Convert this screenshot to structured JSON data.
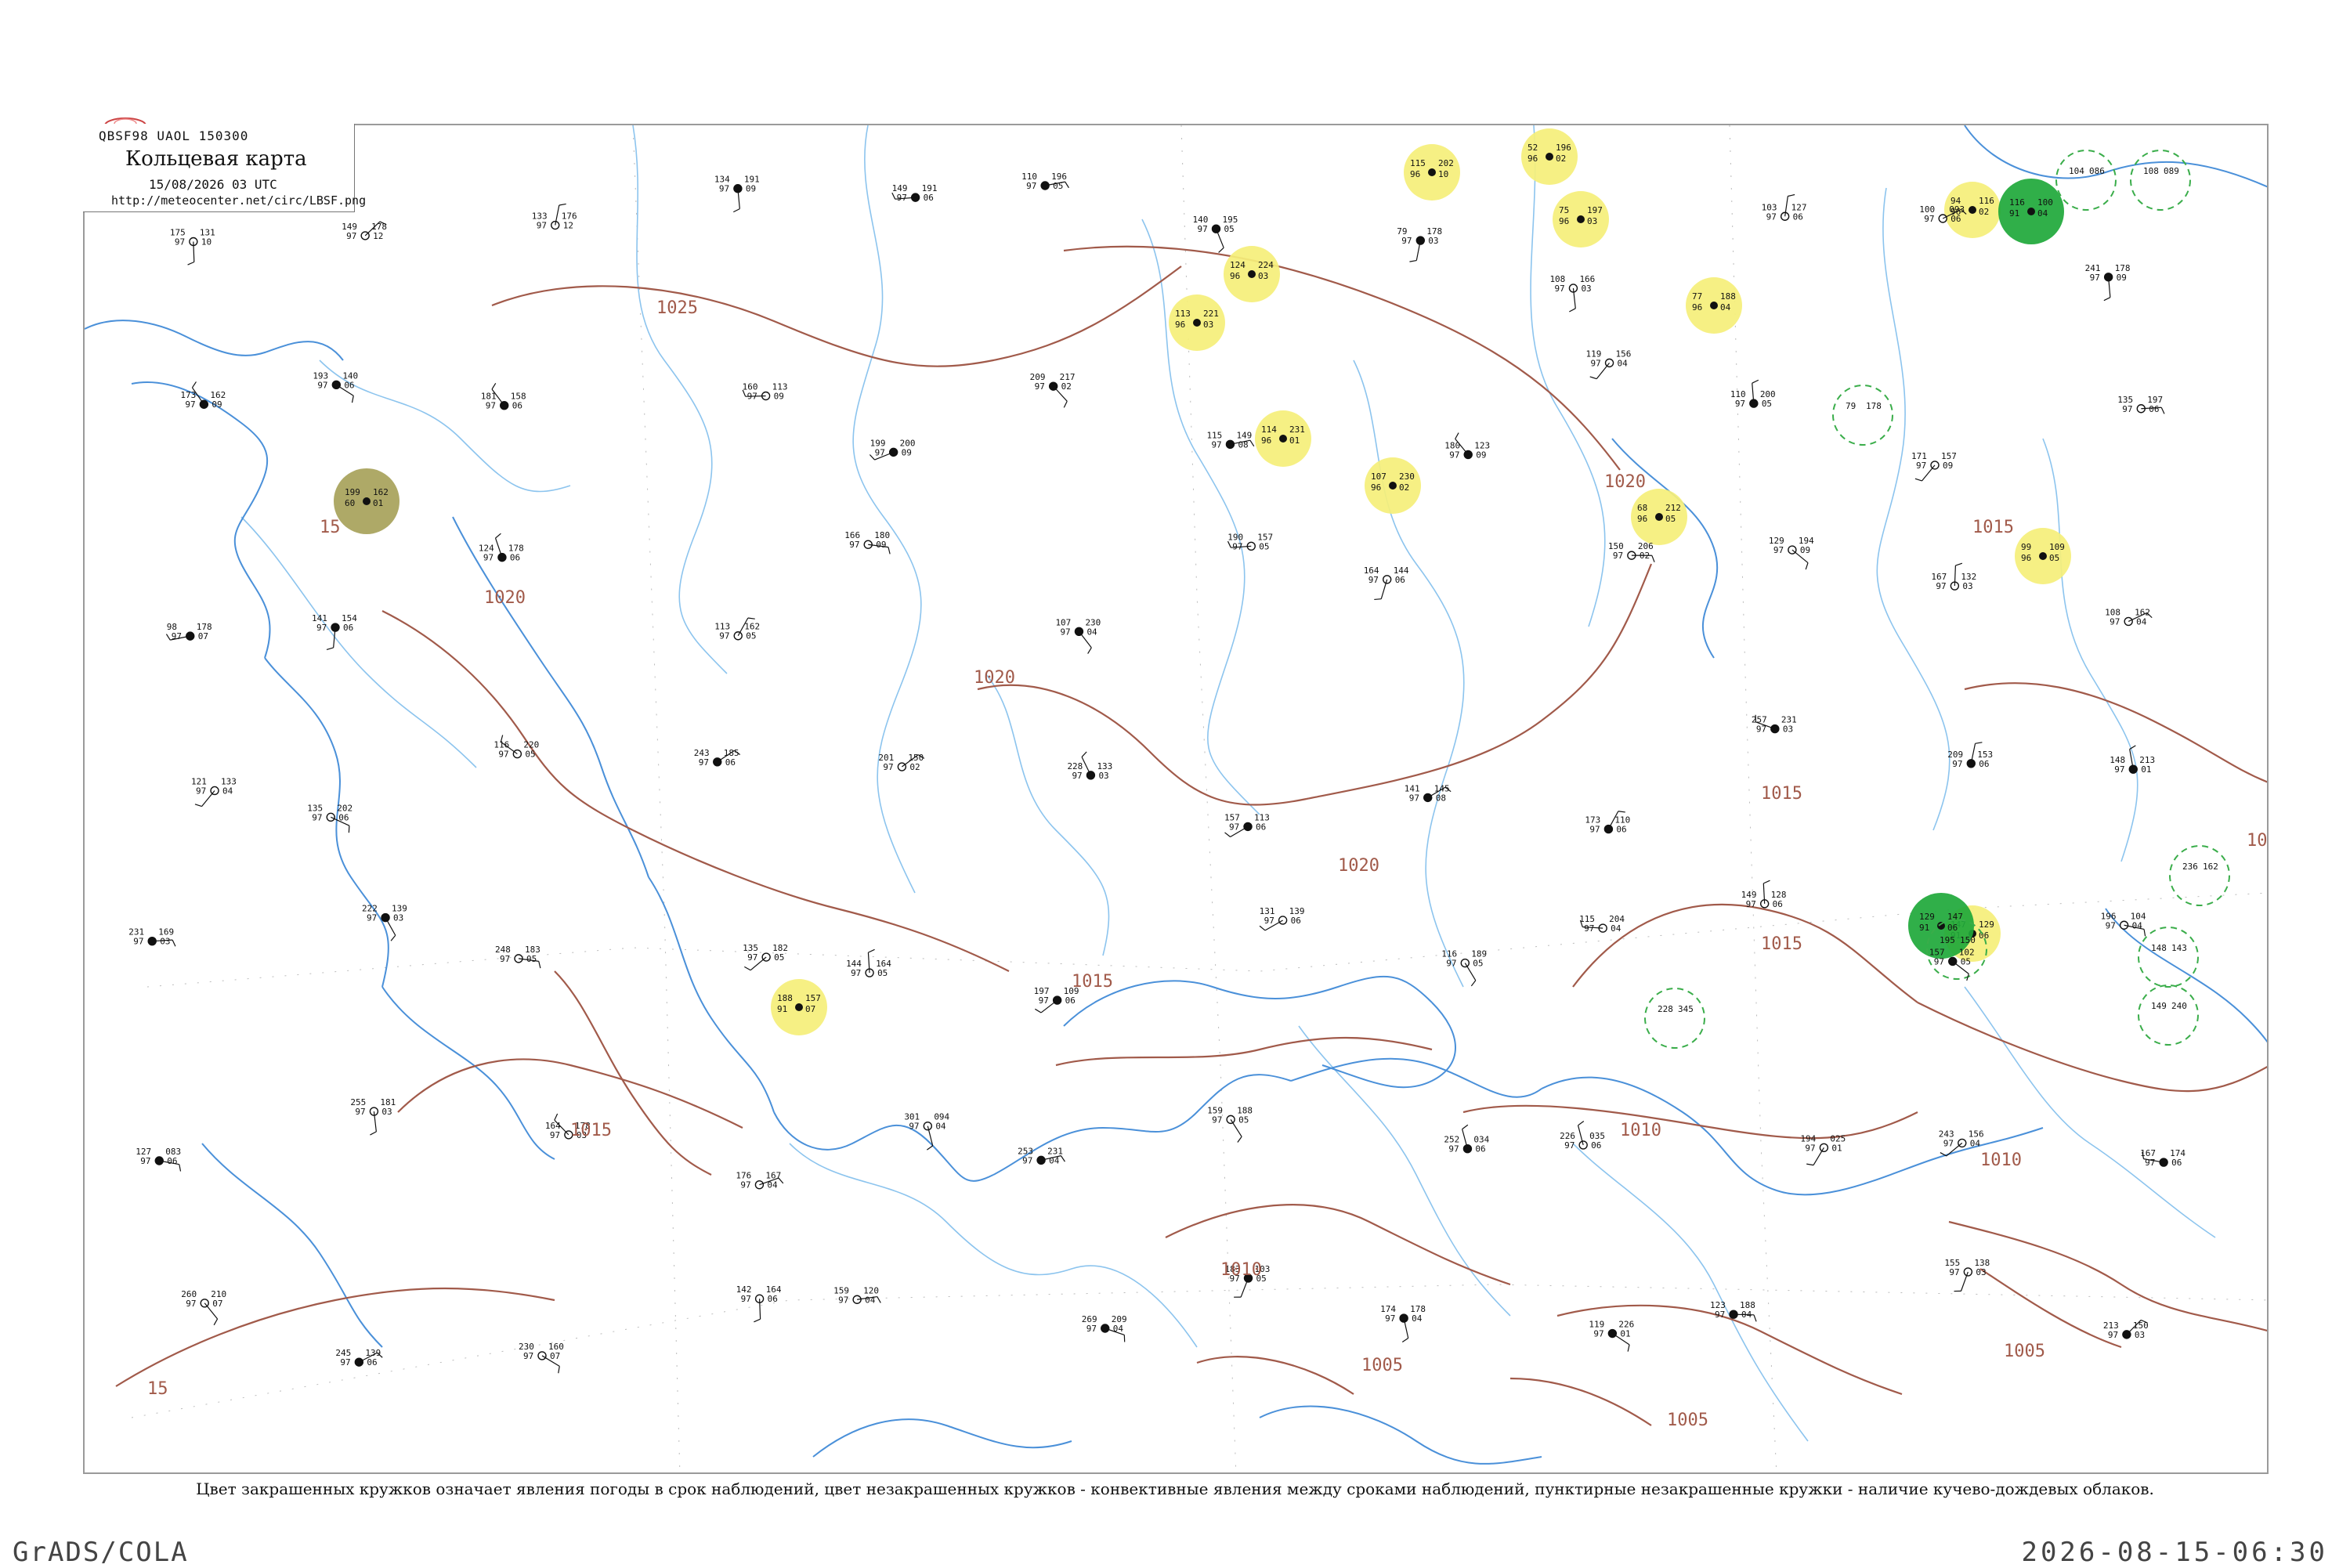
{
  "header": {
    "code_line": "QBSF98  UAOL  150300",
    "title": "Кольцевая карта",
    "time": "15/08/2026 03 UTC",
    "url": "http://meteocenter.net/circ/LBSF.png"
  },
  "caption": "Цвет закрашенных кружков означает явления погоды в срок наблюдений, цвет незакрашенных кружков - конвективные явления между сроками наблюдений, пунктирные незакрашенные кружки - наличие кучево-дождевых облаков.",
  "footer": {
    "left": "GrADS/COLA",
    "right": "2026-08-15-06:30"
  },
  "colors": {
    "coast": "#4a90d9",
    "rivers": "#8cc4ee",
    "isobars": "#a15a4a",
    "frame": "#9a9a9a",
    "highlight_yellow": "#f5ef7a",
    "highlight_green": "#1ea83a",
    "highlight_olive": "#a7a25a",
    "cb_circle": "#3aad4a"
  },
  "isobars": [
    {
      "label": "1025"
    },
    {
      "label": "1020"
    },
    {
      "label": "1020"
    },
    {
      "label": "1020"
    },
    {
      "label": "1020"
    },
    {
      "label": "1015"
    },
    {
      "label": "1015"
    },
    {
      "label": "1015"
    },
    {
      "label": "1015"
    },
    {
      "label": "1015"
    },
    {
      "label": "1015"
    },
    {
      "label": "1010"
    },
    {
      "label": "1010"
    },
    {
      "label": "1010"
    },
    {
      "label": "1005"
    },
    {
      "label": "1005"
    },
    {
      "label": "1005"
    },
    {
      "label": "15"
    },
    {
      "label": "15"
    },
    {
      "label": "1015"
    }
  ],
  "stations": [
    {
      "t": "175",
      "p": "131",
      "d": "97",
      "id": "10"
    },
    {
      "t": "149",
      "p": "178",
      "d": "97",
      "id": "12"
    },
    {
      "t": "133",
      "p": "176",
      "d": "97",
      "id": "12"
    },
    {
      "t": "134",
      "p": "191",
      "d": "97",
      "id": "09"
    },
    {
      "t": "149",
      "p": "191",
      "d": "97",
      "id": "06"
    },
    {
      "t": "110",
      "p": "196",
      "d": "97",
      "id": "05"
    },
    {
      "t": "140",
      "p": "195",
      "d": "97",
      "id": "05"
    },
    {
      "t": "79",
      "p": "178",
      "d": "97",
      "id": "03"
    },
    {
      "t": "108",
      "p": "166",
      "d": "97",
      "id": "03"
    },
    {
      "t": "103",
      "p": "127",
      "d": "97",
      "id": "06"
    },
    {
      "t": "100",
      "p": "093",
      "d": "97",
      "id": "06"
    },
    {
      "t": "241",
      "p": "178",
      "d": "97",
      "id": "09"
    },
    {
      "t": "173",
      "p": "162",
      "d": "97",
      "id": "09"
    },
    {
      "t": "193",
      "p": "140",
      "d": "97",
      "id": "06"
    },
    {
      "t": "181",
      "p": "158",
      "d": "97",
      "id": "06"
    },
    {
      "t": "160",
      "p": "113",
      "d": "97",
      "id": "09"
    },
    {
      "t": "199",
      "p": "200",
      "d": "97",
      "id": "09"
    },
    {
      "t": "209",
      "p": "217",
      "d": "97",
      "id": "02"
    },
    {
      "t": "115",
      "p": "149",
      "d": "97",
      "id": "08"
    },
    {
      "t": "180",
      "p": "123",
      "d": "97",
      "id": "09"
    },
    {
      "t": "119",
      "p": "156",
      "d": "97",
      "id": "04"
    },
    {
      "t": "110",
      "p": "200",
      "d": "97",
      "id": "05"
    },
    {
      "t": "171",
      "p": "157",
      "d": "97",
      "id": "09"
    },
    {
      "t": "135",
      "p": "197",
      "d": "97",
      "id": "06"
    },
    {
      "t": "98",
      "p": "178",
      "d": "97",
      "id": "07"
    },
    {
      "t": "141",
      "p": "154",
      "d": "97",
      "id": "06"
    },
    {
      "t": "124",
      "p": "178",
      "d": "97",
      "id": "06"
    },
    {
      "t": "113",
      "p": "162",
      "d": "97",
      "id": "05"
    },
    {
      "t": "166",
      "p": "180",
      "d": "97",
      "id": "09"
    },
    {
      "t": "107",
      "p": "230",
      "d": "97",
      "id": "04"
    },
    {
      "t": "190",
      "p": "157",
      "d": "97",
      "id": "05"
    },
    {
      "t": "164",
      "p": "144",
      "d": "97",
      "id": "06"
    },
    {
      "t": "150",
      "p": "206",
      "d": "97",
      "id": "02"
    },
    {
      "t": "129",
      "p": "194",
      "d": "97",
      "id": "09"
    },
    {
      "t": "167",
      "p": "132",
      "d": "97",
      "id": "03"
    },
    {
      "t": "108",
      "p": "162",
      "d": "97",
      "id": "04"
    },
    {
      "t": "121",
      "p": "133",
      "d": "97",
      "id": "04"
    },
    {
      "t": "135",
      "p": "202",
      "d": "97",
      "id": "06"
    },
    {
      "t": "116",
      "p": "220",
      "d": "97",
      "id": "05"
    },
    {
      "t": "243",
      "p": "185",
      "d": "97",
      "id": "06"
    },
    {
      "t": "201",
      "p": "150",
      "d": "97",
      "id": "02"
    },
    {
      "t": "228",
      "p": "133",
      "d": "97",
      "id": "03"
    },
    {
      "t": "157",
      "p": "113",
      "d": "97",
      "id": "06"
    },
    {
      "t": "141",
      "p": "145",
      "d": "97",
      "id": "08"
    },
    {
      "t": "173",
      "p": "110",
      "d": "97",
      "id": "06"
    },
    {
      "t": "257",
      "p": "231",
      "d": "97",
      "id": "03"
    },
    {
      "t": "209",
      "p": "153",
      "d": "97",
      "id": "06"
    },
    {
      "t": "148",
      "p": "213",
      "d": "97",
      "id": "01"
    },
    {
      "t": "231",
      "p": "169",
      "d": "97",
      "id": "03"
    },
    {
      "t": "222",
      "p": "139",
      "d": "97",
      "id": "03"
    },
    {
      "t": "248",
      "p": "183",
      "d": "97",
      "id": "05"
    },
    {
      "t": "135",
      "p": "182",
      "d": "97",
      "id": "05"
    },
    {
      "t": "144",
      "p": "164",
      "d": "97",
      "id": "05"
    },
    {
      "t": "197",
      "p": "109",
      "d": "97",
      "id": "06"
    },
    {
      "t": "131",
      "p": "139",
      "d": "97",
      "id": "06"
    },
    {
      "t": "116",
      "p": "189",
      "d": "97",
      "id": "05"
    },
    {
      "t": "115",
      "p": "204",
      "d": "97",
      "id": "04"
    },
    {
      "t": "149",
      "p": "128",
      "d": "97",
      "id": "06"
    },
    {
      "t": "157",
      "p": "102",
      "d": "97",
      "id": "05"
    },
    {
      "t": "196",
      "p": "104",
      "d": "97",
      "id": "04"
    },
    {
      "t": "127",
      "p": "083",
      "d": "97",
      "id": "06"
    },
    {
      "t": "255",
      "p": "181",
      "d": "97",
      "id": "03"
    },
    {
      "t": "164",
      "p": "178",
      "d": "97",
      "id": "03"
    },
    {
      "t": "176",
      "p": "167",
      "d": "97",
      "id": "04"
    },
    {
      "t": "301",
      "p": "094",
      "d": "97",
      "id": "04"
    },
    {
      "t": "253",
      "p": "231",
      "d": "97",
      "id": "04"
    },
    {
      "t": "159",
      "p": "188",
      "d": "97",
      "id": "05"
    },
    {
      "t": "252",
      "p": "034",
      "d": "97",
      "id": "06"
    },
    {
      "t": "226",
      "p": "035",
      "d": "97",
      "id": "06"
    },
    {
      "t": "194",
      "p": "025",
      "d": "97",
      "id": "01"
    },
    {
      "t": "243",
      "p": "156",
      "d": "97",
      "id": "04"
    },
    {
      "t": "167",
      "p": "174",
      "d": "97",
      "id": "06"
    },
    {
      "t": "260",
      "p": "210",
      "d": "97",
      "id": "07"
    },
    {
      "t": "245",
      "p": "139",
      "d": "97",
      "id": "06"
    },
    {
      "t": "230",
      "p": "160",
      "d": "97",
      "id": "07"
    },
    {
      "t": "142",
      "p": "164",
      "d": "97",
      "id": "06"
    },
    {
      "t": "159",
      "p": "120",
      "d": "97",
      "id": "04"
    },
    {
      "t": "269",
      "p": "209",
      "d": "97",
      "id": "04"
    },
    {
      "t": "183",
      "p": "103",
      "d": "97",
      "id": "05"
    },
    {
      "t": "174",
      "p": "178",
      "d": "97",
      "id": "04"
    },
    {
      "t": "119",
      "p": "226",
      "d": "97",
      "id": "01"
    },
    {
      "t": "123",
      "p": "188",
      "d": "97",
      "id": "04"
    },
    {
      "t": "155",
      "p": "138",
      "d": "97",
      "id": "03"
    },
    {
      "t": "213",
      "p": "150",
      "d": "97",
      "id": "03"
    }
  ],
  "highlights": [
    {
      "kind": "yellow",
      "t": "115",
      "p": "202",
      "d": "96",
      "id": "10"
    },
    {
      "kind": "yellow",
      "t": "52",
      "p": "196",
      "d": "96",
      "id": "02"
    },
    {
      "kind": "yellow",
      "t": "75",
      "p": "197",
      "d": "96",
      "id": "03"
    },
    {
      "kind": "yellow",
      "t": "124",
      "p": "224",
      "d": "96",
      "id": "03"
    },
    {
      "kind": "yellow",
      "t": "113",
      "p": "221",
      "d": "96",
      "id": "03"
    },
    {
      "kind": "yellow",
      "t": "77",
      "p": "188",
      "d": "96",
      "id": "04"
    },
    {
      "kind": "yellow",
      "t": "94",
      "p": "116",
      "d": "96",
      "id": "02"
    },
    {
      "kind": "yellow",
      "t": "114",
      "p": "231",
      "d": "96",
      "id": "01"
    },
    {
      "kind": "yellow",
      "t": "107",
      "p": "230",
      "d": "96",
      "id": "02"
    },
    {
      "kind": "yellow",
      "t": "68",
      "p": "212",
      "d": "96",
      "id": "05"
    },
    {
      "kind": "yellow",
      "t": "99",
      "p": "109",
      "d": "96",
      "id": "05"
    },
    {
      "kind": "yellow",
      "t": "188",
      "p": "157",
      "d": "91",
      "id": "07"
    },
    {
      "kind": "yellow",
      "t": "147",
      "p": "129",
      "d": "91",
      "id": "06"
    },
    {
      "kind": "green",
      "t": "129",
      "p": "147",
      "d": "91",
      "id": "06"
    },
    {
      "kind": "green",
      "t": "116",
      "p": "100",
      "d": "91",
      "id": "04"
    },
    {
      "kind": "olive",
      "t": "199",
      "p": "162",
      "d": "60",
      "id": "01"
    }
  ],
  "cb_circles": [
    {
      "t": "104",
      "p": "086"
    },
    {
      "t": "108",
      "p": "089"
    },
    {
      "t": "79",
      "p": "178"
    },
    {
      "t": "228",
      "p": "345"
    },
    {
      "t": "195",
      "p": "150"
    },
    {
      "t": "236",
      "p": "162"
    },
    {
      "t": "148",
      "p": "143"
    },
    {
      "t": "149",
      "p": "240"
    }
  ]
}
